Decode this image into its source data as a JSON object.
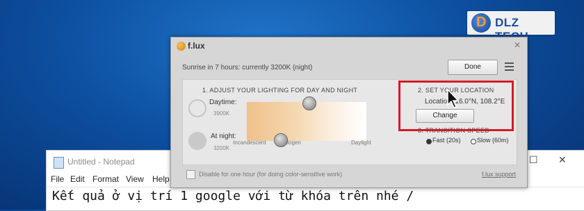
{
  "overlay_logo": {
    "text": "DLZ TECH"
  },
  "notepad": {
    "title": "Untitled - Notepad",
    "menu": [
      "File",
      "Edit",
      "Format",
      "View",
      "Help"
    ],
    "content": "Kết quả ở vị trí 1 google với từ khóa trên nhé /"
  },
  "flux": {
    "title": "f.lux",
    "status": "Sunrise in 7 hours: currently 3200K (night)",
    "done_label": "Done",
    "section1_title": "1. Adjust your lighting for day and night",
    "daytime_label": "Daytime:",
    "daytime_value": "3900K",
    "night_label": "At night:",
    "night_value": "3200K",
    "daytime_level": 0.52,
    "night_level": 0.28,
    "scale_labels": [
      "Incandescent",
      "Halogen",
      "Daylight"
    ],
    "section2_title": "2. Set your location",
    "location_text": "Location: 16.0°N, 108.2°E",
    "change_label": "Change",
    "section3_title": "3. Transition Speed",
    "speed_options": [
      {
        "label": "Fast (20s)",
        "selected": true
      },
      {
        "label": "Slow (60m)",
        "selected": false
      }
    ],
    "disable_label": "Disable for one hour (for doing color-sensitive work)",
    "support_label": "f.lux support"
  },
  "colors": {
    "highlight_box": "#d11b25",
    "desktop": "#0d4fa0"
  }
}
